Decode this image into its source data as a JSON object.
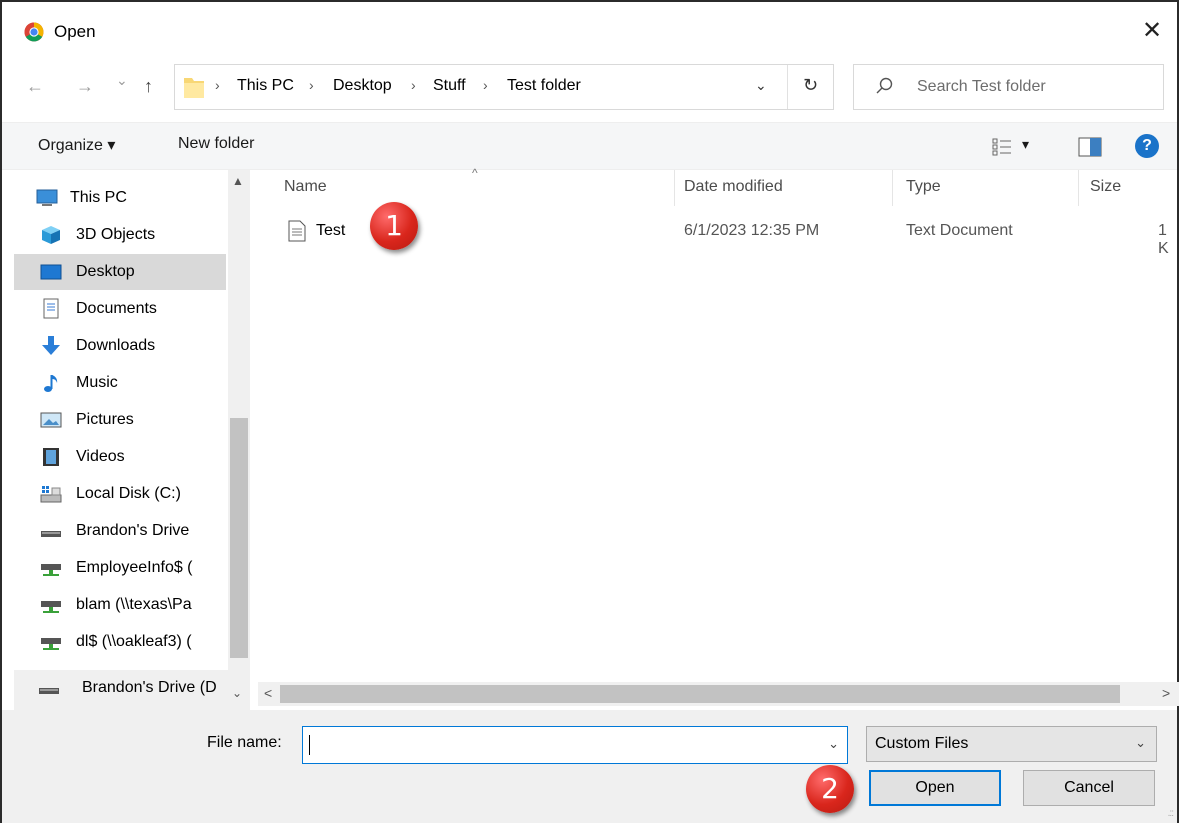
{
  "window": {
    "title": "Open",
    "app_icon": "chrome-icon",
    "close_glyph": "✕"
  },
  "nav": {
    "back": "←",
    "forward": "→",
    "history": "⌄",
    "up": "↑",
    "breadcrumb": [
      "This PC",
      "Desktop",
      "Stuff",
      "Test folder"
    ],
    "separator": "›",
    "address_dropdown": "⌄",
    "refresh": "↻",
    "search_placeholder": "Search Test folder"
  },
  "toolbar": {
    "organize": "Organize ▾",
    "new_folder": "New folder",
    "view_dropdown": "▾",
    "help": "?"
  },
  "sidebar": {
    "items": [
      {
        "label": "This PC",
        "icon": "pc-icon"
      },
      {
        "label": "3D Objects",
        "icon": "3d-objects-icon"
      },
      {
        "label": "Desktop",
        "icon": "desktop-icon",
        "selected": true
      },
      {
        "label": "Documents",
        "icon": "documents-icon"
      },
      {
        "label": "Downloads",
        "icon": "downloads-icon"
      },
      {
        "label": "Music",
        "icon": "music-icon"
      },
      {
        "label": "Pictures",
        "icon": "pictures-icon"
      },
      {
        "label": "Videos",
        "icon": "videos-icon"
      },
      {
        "label": "Local Disk (C:)",
        "icon": "local-disk-icon"
      },
      {
        "label": "Brandon's Drive",
        "icon": "drive-icon"
      },
      {
        "label": "EmployeeInfo$ (",
        "icon": "network-drive-icon"
      },
      {
        "label": "blam (\\\\texas\\Pa",
        "icon": "network-drive-icon"
      },
      {
        "label": "dl$ (\\\\oakleaf3) (",
        "icon": "network-drive-icon"
      },
      {
        "label": "Brandon's Drive (D",
        "icon": "drive-icon"
      }
    ],
    "scroll_up": "▲",
    "scroll_down": "⌄"
  },
  "filelist": {
    "columns": [
      "Name",
      "Date modified",
      "Type",
      "Size"
    ],
    "sort_indicator": "^",
    "rows": [
      {
        "name": "Test",
        "date": "6/1/2023 12:35 PM",
        "type": "Text Document",
        "size": "1 K",
        "icon": "text-document-icon"
      }
    ],
    "scroll_left": "<",
    "scroll_right": ">"
  },
  "bottom": {
    "file_name_label": "File name:",
    "file_name_value": "",
    "file_name_dropdown": "⌄",
    "filter_value": "Custom Files",
    "filter_dropdown": "⌄",
    "open_label": "Open",
    "cancel_label": "Cancel",
    "grip": ".::"
  },
  "markers": [
    "1",
    "2"
  ],
  "colors": {
    "accent": "#0078d7",
    "marker": "#d9261c",
    "selected_bg": "#d9d9d9"
  }
}
